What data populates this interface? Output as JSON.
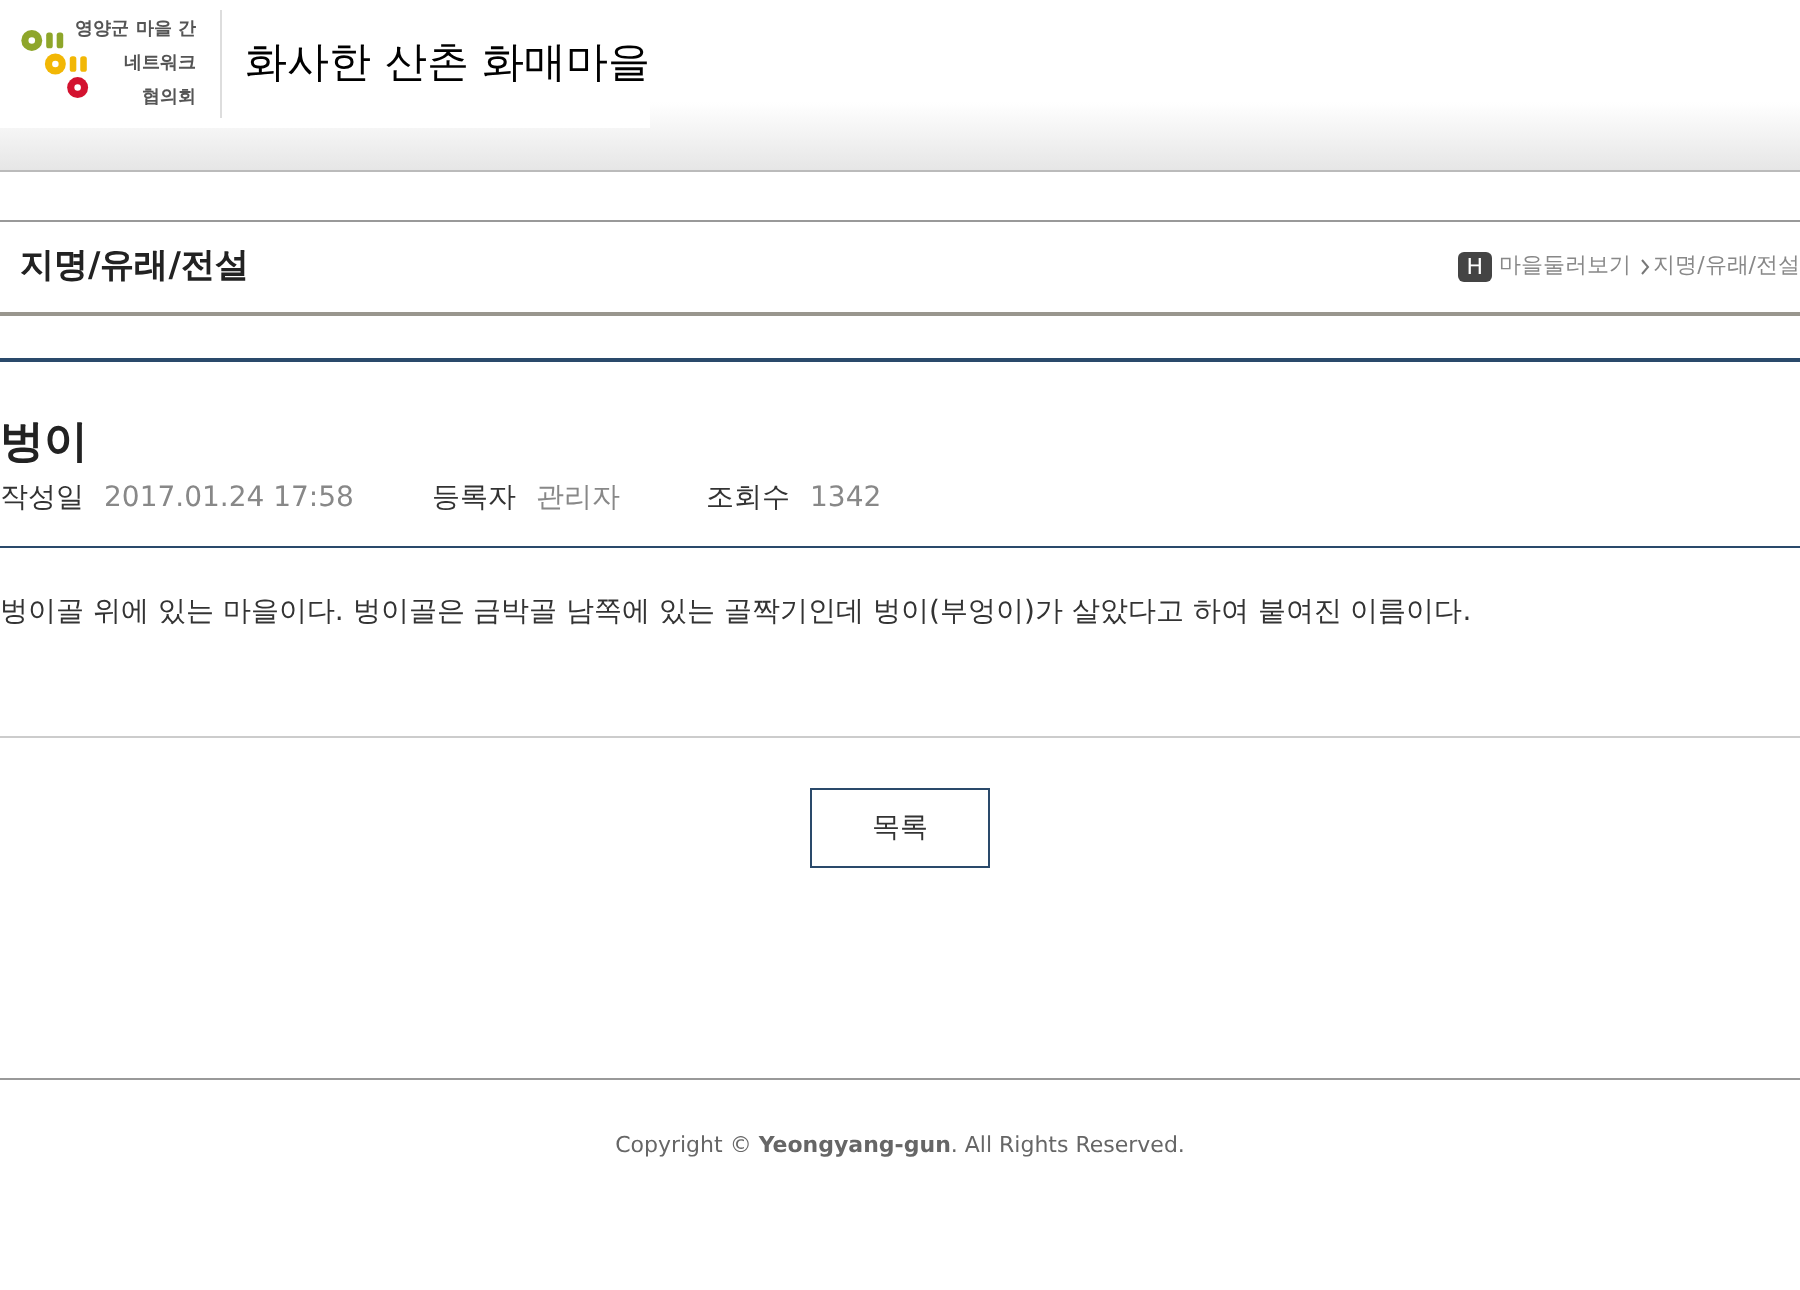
{
  "logo": {
    "lines": [
      "영양군 마을 간",
      "네트워크",
      "협의회"
    ]
  },
  "site_title": "화사한 산촌 화매마을",
  "page_title": "지명/유래/전설",
  "breadcrumb": {
    "home": "H",
    "items": [
      "마을둘러보기",
      "지명/유래/전설"
    ]
  },
  "post": {
    "title": "벙이",
    "meta": [
      {
        "label": "작성일",
        "value": "2017.01.24 17:58"
      },
      {
        "label": "등록자",
        "value": "관리자"
      },
      {
        "label": "조회수",
        "value": "1342"
      }
    ],
    "body": "벙이골 위에 있는 마을이다. 벙이골은 금박골 남쪽에 있는 골짝기인데 벙이(부엉이)가 살았다고 하여 붙여진 이름이다."
  },
  "list_button": "목록",
  "footer": "Copyright © **Yeongyang-gun**. All Rights Reserved."
}
